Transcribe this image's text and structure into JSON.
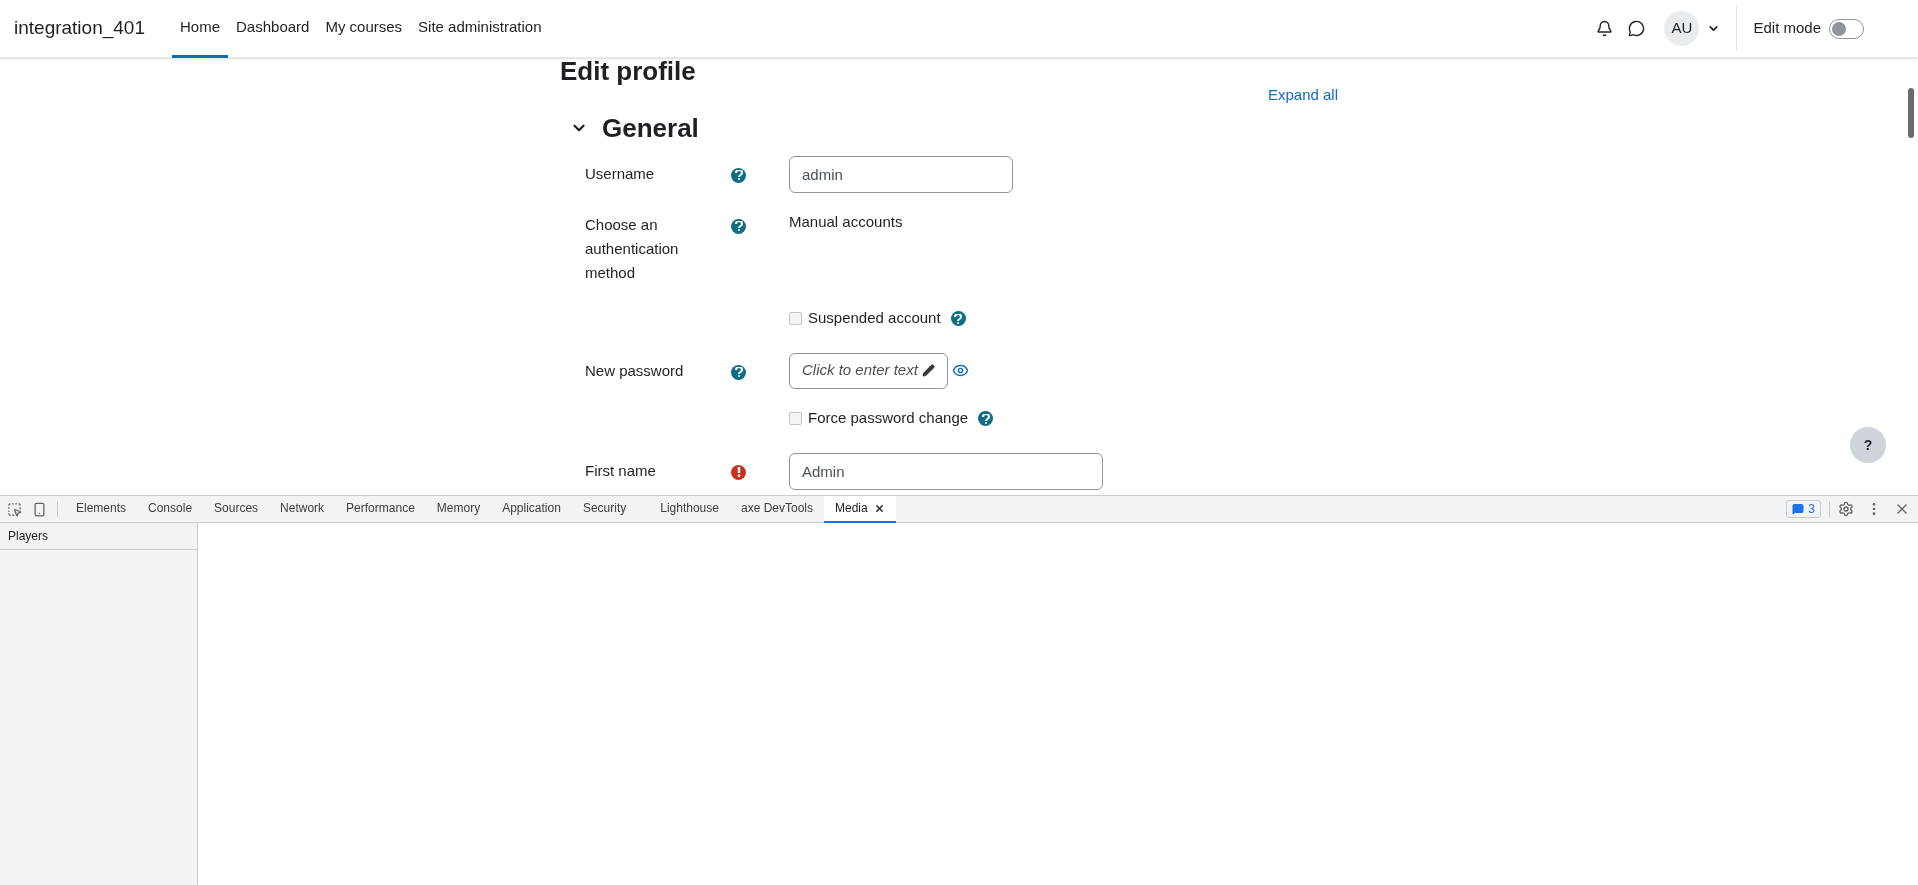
{
  "navbar": {
    "site_name": "integration_401",
    "links": [
      {
        "label": "Home",
        "selected": true
      },
      {
        "label": "Dashboard",
        "selected": false
      },
      {
        "label": "My courses",
        "selected": false
      },
      {
        "label": "Site administration",
        "selected": false
      }
    ],
    "avatar": "AU",
    "edit_mode": {
      "label": "Edit mode",
      "on": false
    }
  },
  "page": {
    "title": "Edit profile",
    "expand_all": "Expand all",
    "section": {
      "title": "General",
      "expanded": true
    },
    "rows": [
      {
        "kind": "input",
        "label": "Username",
        "required": false,
        "value": "admin"
      },
      {
        "kind": "static",
        "label": "Choose an authentication method",
        "required": false,
        "value": "Manual accounts"
      },
      {
        "kind": "checkbox",
        "label": "Suspended account",
        "checked": false
      },
      {
        "kind": "password",
        "label": "New password",
        "required": false,
        "placeholder": "Click to enter text"
      },
      {
        "kind": "checkbox",
        "label": "Force password change",
        "checked": false
      },
      {
        "kind": "input",
        "label": "First name",
        "required": true,
        "value": "Admin"
      }
    ]
  },
  "help_button": "?",
  "devtools": {
    "tabs": [
      {
        "label": "Elements",
        "selected": false
      },
      {
        "label": "Console",
        "selected": false
      },
      {
        "label": "Sources",
        "selected": false
      },
      {
        "label": "Network",
        "selected": false
      },
      {
        "label": "Performance",
        "selected": false
      },
      {
        "label": "Memory",
        "selected": false
      },
      {
        "label": "Application",
        "selected": false
      },
      {
        "label": "Security",
        "selected": false
      },
      {
        "label": "Lighthouse",
        "selected": false
      },
      {
        "label": "axe DevTools",
        "selected": false
      },
      {
        "label": "Media",
        "selected": true
      }
    ],
    "issues_count": "3",
    "sidebar": {
      "title": "Players"
    }
  }
}
